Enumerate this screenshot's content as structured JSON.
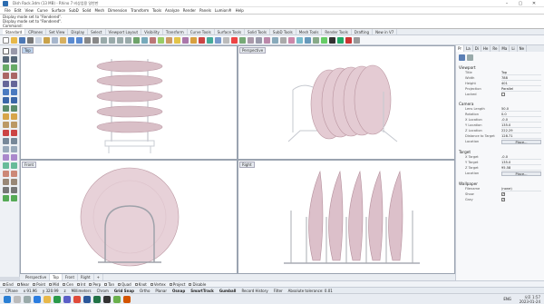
{
  "window": {
    "title": "Dish Rack.3dm (13 MB) - Rhino 7 비상업용 일반판",
    "min": "–",
    "max": "▢",
    "close": "✕"
  },
  "menu": [
    "File",
    "Edit",
    "View",
    "Curve",
    "Surface",
    "SubD",
    "Solid",
    "Mesh",
    "Dimension",
    "Transform",
    "Tools",
    "Analyze",
    "Render",
    "Panels",
    "Lumion®",
    "Help"
  ],
  "command": {
    "lines": [
      "Display mode set to \"Rendered\".",
      "Display mode set to \"Rendered\".",
      "Command:"
    ]
  },
  "toolbar_tabs": [
    {
      "label": "Standard",
      "active": true
    },
    {
      "label": "CPlanes"
    },
    {
      "label": "Set View"
    },
    {
      "label": "Display"
    },
    {
      "label": "Select"
    },
    {
      "label": "Viewport Layout"
    },
    {
      "label": "Visibility"
    },
    {
      "label": "Transform"
    },
    {
      "label": "Curve Tools"
    },
    {
      "label": "Surface Tools"
    },
    {
      "label": "Solid Tools"
    },
    {
      "label": "SubD Tools"
    },
    {
      "label": "Mesh Tools"
    },
    {
      "label": "Render Tools"
    },
    {
      "label": "Drafting"
    },
    {
      "label": "New in V7"
    }
  ],
  "viewports": [
    {
      "name": "Top",
      "active": true
    },
    {
      "name": "Perspective"
    },
    {
      "name": "Front"
    },
    {
      "name": "Right"
    }
  ],
  "viewport_tabs": [
    "Perspective",
    "Top",
    "Front",
    "Right",
    "+"
  ],
  "panel": {
    "tabs": [
      "Pr",
      "La",
      "Di",
      "He",
      "Re",
      "Ma",
      "Li",
      "Ne"
    ],
    "viewport_heading": "Viewport",
    "viewport_rows": [
      {
        "k": "Title",
        "v": "Top"
      },
      {
        "k": "Width",
        "v": "788"
      },
      {
        "k": "Height",
        "v": "401"
      },
      {
        "k": "Projection",
        "v": "Parallel"
      },
      {
        "k": "Locked",
        "v": ""
      }
    ],
    "camera_heading": "Camera",
    "camera_rows": [
      {
        "k": "Lens Length",
        "v": "50.0"
      },
      {
        "k": "Rotation",
        "v": "0.0"
      },
      {
        "k": "X Location",
        "v": "-0.0"
      },
      {
        "k": "Y Location",
        "v": "135.0"
      },
      {
        "k": "Z Location",
        "v": "222.29"
      },
      {
        "k": "Distance to Target",
        "v": "128.71"
      }
    ],
    "camera_location_btn": "Place...",
    "target_heading": "Target",
    "target_rows": [
      {
        "k": "X Target",
        "v": "-0.0"
      },
      {
        "k": "Y Target",
        "v": "135.0"
      },
      {
        "k": "Z Target",
        "v": "95.58"
      }
    ],
    "target_location_btn": "Place...",
    "wallpaper_heading": "Wallpaper",
    "wallpaper_rows": [
      {
        "k": "Filename",
        "v": "(none)"
      },
      {
        "k": "Show",
        "v": "✓"
      },
      {
        "k": "Gray",
        "v": "✓"
      }
    ],
    "location_label": "Location"
  },
  "osnap": [
    "End",
    "Near",
    "Point",
    "Mid",
    "Cen",
    "Int",
    "Perp",
    "Tan",
    "Quad",
    "Knot",
    "Vertex",
    "Project",
    "Disable"
  ],
  "status": {
    "cplane": "CPlane",
    "x": "x 91.96",
    "y": "y 320.99",
    "z": "z",
    "units": "Millimeters",
    "layer": "Chrom",
    "items": [
      "Grid Snap",
      "Ortho",
      "Planar",
      "Osnap",
      "SmartTrack",
      "Gumball",
      "Record History",
      "Filter"
    ],
    "tolerance": "Absolute tolerance: 0.01"
  },
  "taskbar": {
    "time": "오후 1:57",
    "date": "2023-01-24",
    "lang": "ENG"
  }
}
